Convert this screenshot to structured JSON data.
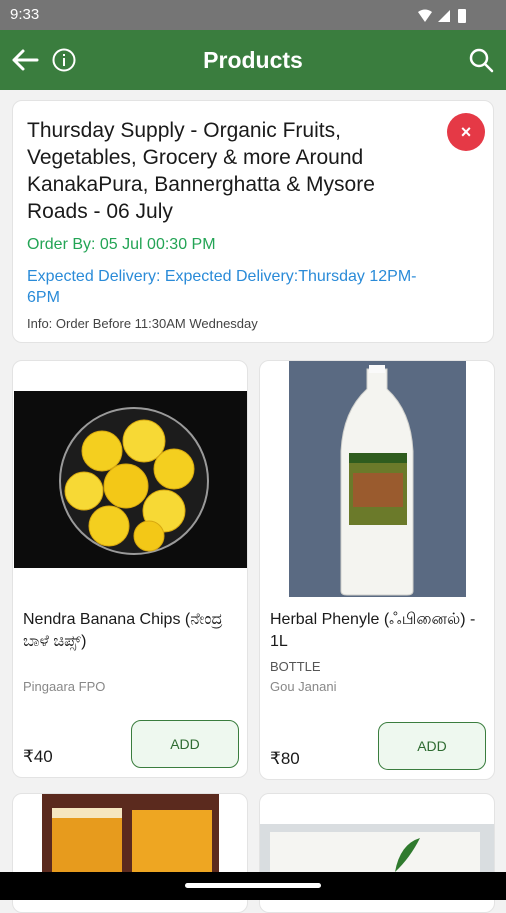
{
  "status": {
    "time": "9:33"
  },
  "appbar": {
    "title": "Products",
    "back_icon": "arrow-left-icon",
    "info_icon": "info-icon",
    "search_icon": "search-icon"
  },
  "supply": {
    "title": "Thursday Supply - Organic Fruits, Vegetables, Grocery & more Around KanakaPura, Bannerghatta & Mysore Roads - 06 July",
    "order_by": "Order By: 05 Jul 00:30 PM",
    "delivery": "Expected Delivery: Expected Delivery:Thursday 12PM-6PM",
    "info": "Info: Order Before 11:30AM Wednesday",
    "close_symbol": "×"
  },
  "products": [
    {
      "name": "Nendra Banana Chips (ನೇಂದ್ರ ಬಾಳೆ ಚಿಪ್ಸ್)",
      "unit": "",
      "seller": "Pingaara FPO",
      "price": "₹40",
      "add_label": "ADD"
    },
    {
      "name": "Herbal Phenyle (ஃபினைல்) - 1L",
      "unit": "BOTTLE",
      "seller": "Gou Janani",
      "price": "₹80",
      "add_label": "ADD"
    }
  ],
  "colors": {
    "appbar": "#3a7d3e",
    "order_green": "#23a455",
    "delivery_blue": "#2a8bd8",
    "close_red": "#e53946"
  }
}
